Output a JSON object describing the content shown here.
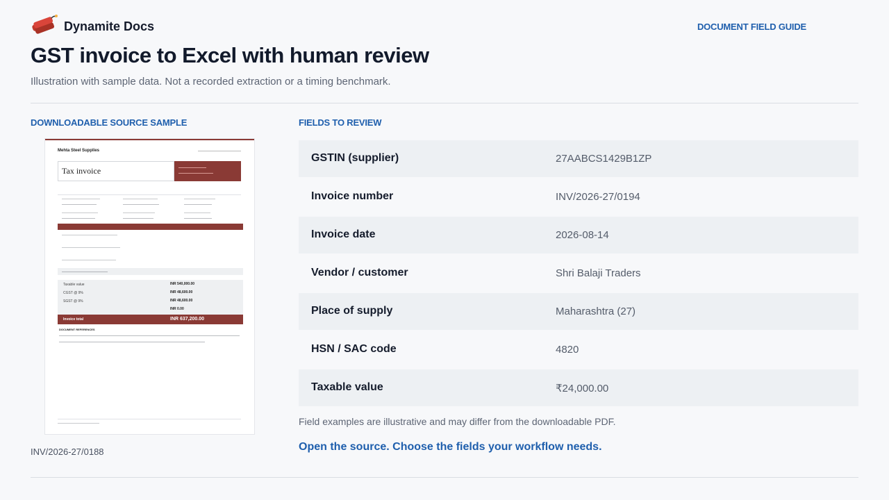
{
  "header": {
    "brand_name": "Dynamite Docs",
    "logo_icon": "dynamite-icon",
    "guide_link": "DOCUMENT FIELD GUIDE"
  },
  "page": {
    "title": "GST invoice to Excel with human review",
    "subtitle": "Illustration with sample data. Not a recorded extraction or a timing benchmark."
  },
  "source": {
    "section_label": "DOWNLOADABLE SOURCE SAMPLE",
    "caption": "INV/2026-27/0188",
    "thumbnail": {
      "supplier": "Mehta Steel Supplies",
      "doc_title": "Tax invoice",
      "subtotal_label": "Taxable value",
      "subtotal_value": "INR 540,000.00",
      "cgst_label": "CGST @ 9%",
      "cgst_value": "INR 48,600.00",
      "sgst_label": "SGST @ 9%",
      "sgst_value": "INR 48,600.00",
      "other_value": "INR 0.00",
      "total_label": "Invoice total",
      "total_value": "INR 637,200.00",
      "notes_label": "DOCUMENT REFERENCES"
    }
  },
  "fields": {
    "section_label": "FIELDS TO REVIEW",
    "rows": [
      {
        "label": "GSTIN (supplier)",
        "value": "27AABCS1429B1ZP"
      },
      {
        "label": "Invoice number",
        "value": "INV/2026-27/0194"
      },
      {
        "label": "Invoice date",
        "value": "2026-08-14"
      },
      {
        "label": "Vendor / customer",
        "value": "Shri Balaji Traders"
      },
      {
        "label": "Place of supply",
        "value": "Maharashtra (27)"
      },
      {
        "label": "HSN / SAC code",
        "value": "4820"
      },
      {
        "label": "Taxable value",
        "value": "₹24,000.00"
      }
    ],
    "note": "Field examples are illustrative and may differ from the downloadable PDF.",
    "cta": "Open the source. Choose the fields your workflow needs."
  },
  "colors": {
    "accent": "#1f5fad",
    "invoice_red": "#8a3a35",
    "row_shade": "#edf0f3"
  }
}
